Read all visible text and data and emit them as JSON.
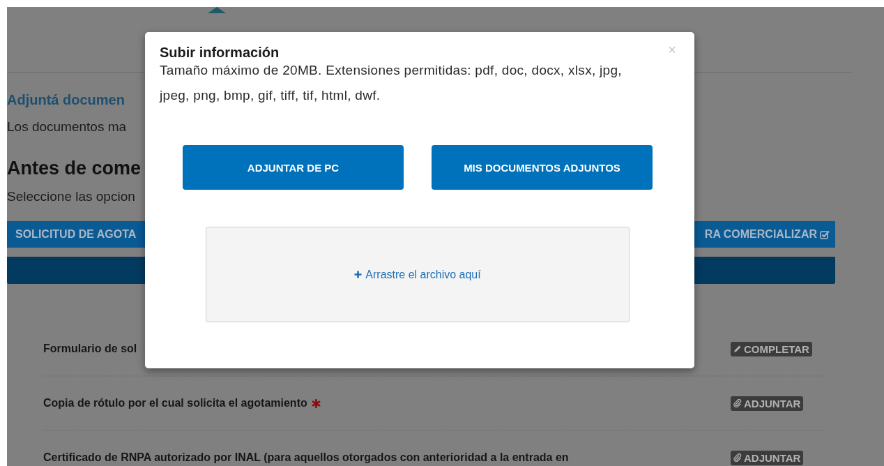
{
  "page": {
    "heading": "Adjuntá documen",
    "intro": "Los documentos ma",
    "section_title": "Antes de come",
    "instruction": "Seleccione las opcion",
    "tabs": [
      {
        "label": "SOLICITUD DE AGOTA",
        "checked": false
      },
      {
        "label": "RA COMERCIALIZAR",
        "checked": true
      }
    ],
    "documents": [
      {
        "name": "Formulario de sol",
        "required": false,
        "action": {
          "kind": "complete",
          "label": "COMPLETAR"
        }
      },
      {
        "name": "Copia de rótulo por el cual solicita el agotamiento",
        "required": true,
        "action": {
          "kind": "attach",
          "label": "ADJUNTAR"
        }
      },
      {
        "name": "Certificado de RNPA autorizado por INAL (para aquellos otorgados con anterioridad a la entrada en",
        "required": false,
        "action": {
          "kind": "attach",
          "label": "ADJUNTAR"
        }
      }
    ]
  },
  "modal": {
    "title": "Subir información",
    "close": "×",
    "description": "Tamaño máximo de 20MB. Extensiones permitidas: pdf, doc, docx, xlsx, jpg, jpeg, png, bmp, gif, tiff, tif, html, dwf.",
    "buttons": [
      "ADJUNTAR DE PC",
      "MIS DOCUMENTOS ADJUNTOS"
    ],
    "dropzone": {
      "label": "Arrastre el archivo aquí"
    }
  }
}
